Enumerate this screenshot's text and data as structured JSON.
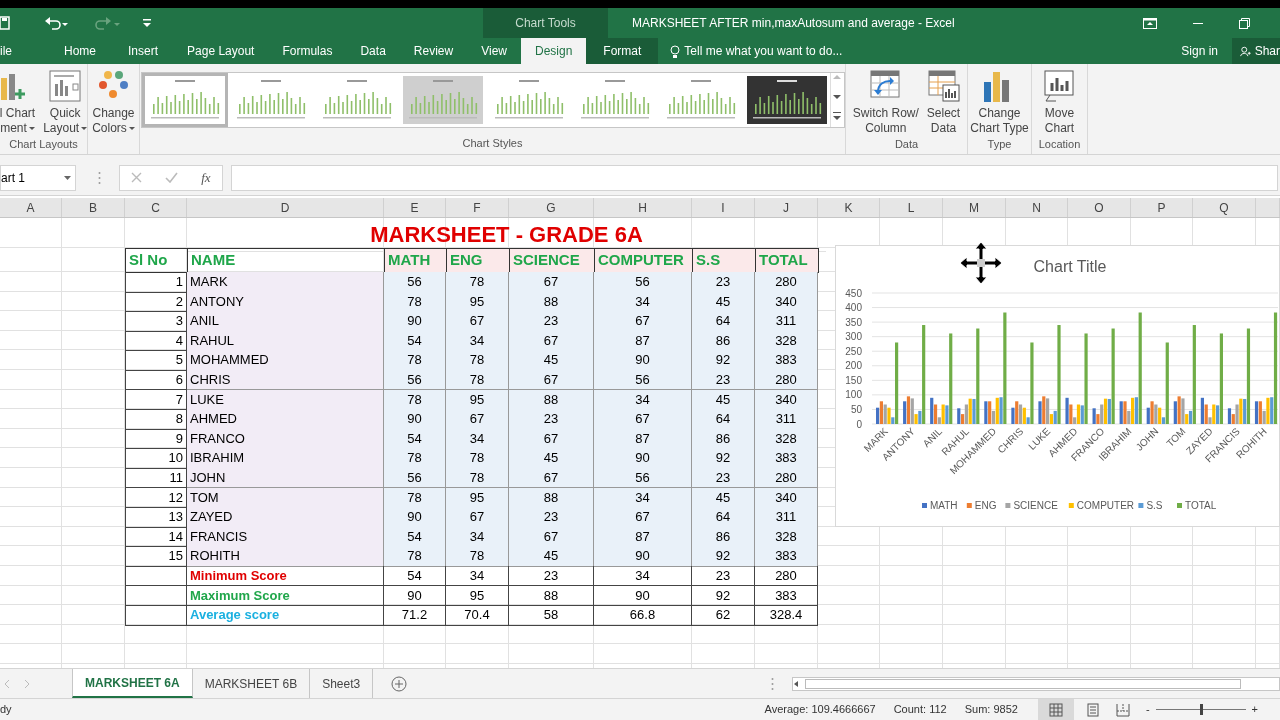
{
  "title_bar": {
    "context_tab": "Chart Tools",
    "title": "MARKSHEET AFTER min,maxAutosum and average - Excel"
  },
  "ribbon_tabs": [
    {
      "label": "ile",
      "selected": false
    },
    {
      "label": "Home",
      "selected": false
    },
    {
      "label": "Insert",
      "selected": false
    },
    {
      "label": "Page Layout",
      "selected": false
    },
    {
      "label": "Formulas",
      "selected": false
    },
    {
      "label": "Data",
      "selected": false
    },
    {
      "label": "Review",
      "selected": false
    },
    {
      "label": "View",
      "selected": false
    },
    {
      "label": "Design",
      "selected": true,
      "kind": "context"
    },
    {
      "label": "Format",
      "selected": false,
      "kind": "context"
    }
  ],
  "tell_me": "Tell me what you want to do...",
  "sign_in": "Sign in",
  "share": "Shar",
  "ribbon_groups": [
    {
      "label": "Chart Layouts",
      "buttons": [
        {
          "kind": "add-element",
          "lines": [
            "l Chart",
            "ment"
          ],
          "dropdown": true
        },
        {
          "kind": "quick-layout",
          "lines": [
            "Quick",
            "Layout"
          ],
          "dropdown": true
        }
      ]
    },
    {
      "buttons": [
        {
          "kind": "colors",
          "lines": [
            "Change",
            "Colors"
          ],
          "dropdown": true
        }
      ]
    },
    {
      "label": "Chart Styles",
      "gallery": [
        {
          "kind": "light",
          "selected": true
        },
        {
          "kind": "light",
          "selected": false
        },
        {
          "kind": "light",
          "selected": false
        },
        {
          "kind": "gray",
          "selected": false
        },
        {
          "kind": "light",
          "selected": false
        },
        {
          "kind": "light",
          "selected": false
        },
        {
          "kind": "light",
          "selected": false
        },
        {
          "kind": "dark",
          "selected": false
        }
      ]
    },
    {
      "label": "Data",
      "buttons": [
        {
          "kind": "switch",
          "lines": [
            "Switch Row/",
            "Column"
          ],
          "dropdown": false
        },
        {
          "kind": "select-data",
          "lines": [
            "Select",
            "Data"
          ],
          "dropdown": false
        }
      ]
    },
    {
      "label": "Type",
      "buttons": [
        {
          "kind": "chart-type",
          "lines": [
            "Change",
            "Chart Type"
          ],
          "dropdown": false
        }
      ]
    },
    {
      "label": "Location",
      "buttons": [
        {
          "kind": "move",
          "lines": [
            "Move",
            "Chart"
          ],
          "dropdown": false
        }
      ]
    }
  ],
  "formula_bar": {
    "name_box": "art 1",
    "function_label": "fx"
  },
  "columns": [
    "A",
    "B",
    "C",
    "D",
    "E",
    "F",
    "G",
    "H",
    "I",
    "J",
    "K",
    "L",
    "M",
    "N",
    "O",
    "P",
    "Q"
  ],
  "sheet": {
    "title": "MARKSHEET - GRADE 6A",
    "headers": [
      "Sl No",
      "NAME",
      "MATH",
      "ENG",
      "SCIENCE",
      "COMPUTER",
      "S.S",
      "TOTAL"
    ],
    "rows": [
      [
        "1",
        "MARK",
        "56",
        "78",
        "67",
        "56",
        "23",
        "280"
      ],
      [
        "2",
        "ANTONY",
        "78",
        "95",
        "88",
        "34",
        "45",
        "340"
      ],
      [
        "3",
        "ANIL",
        "90",
        "67",
        "23",
        "67",
        "64",
        "311"
      ],
      [
        "4",
        "RAHUL",
        "54",
        "34",
        "67",
        "87",
        "86",
        "328"
      ],
      [
        "5",
        "MOHAMMED",
        "78",
        "78",
        "45",
        "90",
        "92",
        "383"
      ],
      [
        "6",
        "CHRIS",
        "56",
        "78",
        "67",
        "56",
        "23",
        "280"
      ],
      [
        "7",
        "LUKE",
        "78",
        "95",
        "88",
        "34",
        "45",
        "340"
      ],
      [
        "8",
        "AHMED",
        "90",
        "67",
        "23",
        "67",
        "64",
        "311"
      ],
      [
        "9",
        "FRANCO",
        "54",
        "34",
        "67",
        "87",
        "86",
        "328"
      ],
      [
        "10",
        "IBRAHIM",
        "78",
        "78",
        "45",
        "90",
        "92",
        "383"
      ],
      [
        "11",
        "JOHN",
        "56",
        "78",
        "67",
        "56",
        "23",
        "280"
      ],
      [
        "12",
        "TOM",
        "78",
        "95",
        "88",
        "34",
        "45",
        "340"
      ],
      [
        "13",
        "ZAYED",
        "90",
        "67",
        "23",
        "67",
        "64",
        "311"
      ],
      [
        "14",
        "FRANCIS",
        "54",
        "34",
        "67",
        "87",
        "86",
        "328"
      ],
      [
        "15",
        "ROHITH",
        "78",
        "78",
        "45",
        "90",
        "92",
        "383"
      ]
    ],
    "summary": [
      {
        "label": "Minimum Score",
        "color": "#e00000",
        "values": [
          "54",
          "34",
          "23",
          "34",
          "23",
          "280"
        ]
      },
      {
        "label": "Maximum Score",
        "color": "#1fa64a",
        "values": [
          "90",
          "95",
          "88",
          "90",
          "92",
          "383"
        ]
      },
      {
        "label": "Average score",
        "color": "#1ab0e0",
        "values": [
          "71.2",
          "70.4",
          "58",
          "66.8",
          "62",
          "328.4"
        ]
      }
    ]
  },
  "chart": {
    "chart_data": {
      "type": "bar",
      "title": "Chart Title",
      "grid": true,
      "legend": true,
      "categories": [
        "MARK",
        "ANTONY",
        "ANIL",
        "RAHUL",
        "MOHAMMED",
        "CHRIS",
        "LUKE",
        "AHMED",
        "FRANCO",
        "IBRAHIM",
        "JOHN",
        "TOM",
        "ZAYED",
        "FRANCIS",
        "ROHITH"
      ],
      "ylim": [
        0,
        450
      ],
      "yticks": [
        0,
        50,
        100,
        150,
        200,
        250,
        300,
        350,
        400,
        450
      ],
      "series": [
        {
          "name": "MATH",
          "color": "#4472c4",
          "values": [
            56,
            78,
            90,
            54,
            78,
            56,
            78,
            90,
            54,
            78,
            56,
            78,
            90,
            54,
            78
          ]
        },
        {
          "name": "ENG",
          "color": "#ed7d31",
          "values": [
            78,
            95,
            67,
            34,
            78,
            78,
            95,
            67,
            34,
            78,
            78,
            95,
            67,
            34,
            78
          ]
        },
        {
          "name": "SCIENCE",
          "color": "#a5a5a5",
          "values": [
            67,
            88,
            23,
            67,
            45,
            67,
            88,
            23,
            67,
            45,
            67,
            88,
            23,
            67,
            45
          ]
        },
        {
          "name": "COMPUTER",
          "color": "#ffc000",
          "values": [
            56,
            34,
            67,
            87,
            90,
            56,
            34,
            67,
            87,
            90,
            56,
            34,
            67,
            87,
            90
          ]
        },
        {
          "name": "S.S",
          "color": "#5b9bd5",
          "values": [
            23,
            45,
            64,
            86,
            92,
            23,
            45,
            64,
            86,
            92,
            23,
            45,
            64,
            86,
            92
          ]
        },
        {
          "name": "TOTAL",
          "color": "#70ad47",
          "values": [
            280,
            340,
            311,
            328,
            383,
            280,
            340,
            311,
            328,
            383,
            280,
            340,
            311,
            328,
            383
          ]
        }
      ]
    }
  },
  "sheet_tabs": [
    {
      "label": "MARKSHEET 6A",
      "selected": true
    },
    {
      "label": "MARKSHEET 6B",
      "selected": false
    },
    {
      "label": "Sheet3",
      "selected": false
    }
  ],
  "status_bar": {
    "mode": "dy",
    "stats": [
      "Average: 109.4666667",
      "Count: 112",
      "Sum: 9852"
    ],
    "zoom_out": "-",
    "zoom_in": "+",
    "zoom": {
      "level": 0.5
    }
  }
}
